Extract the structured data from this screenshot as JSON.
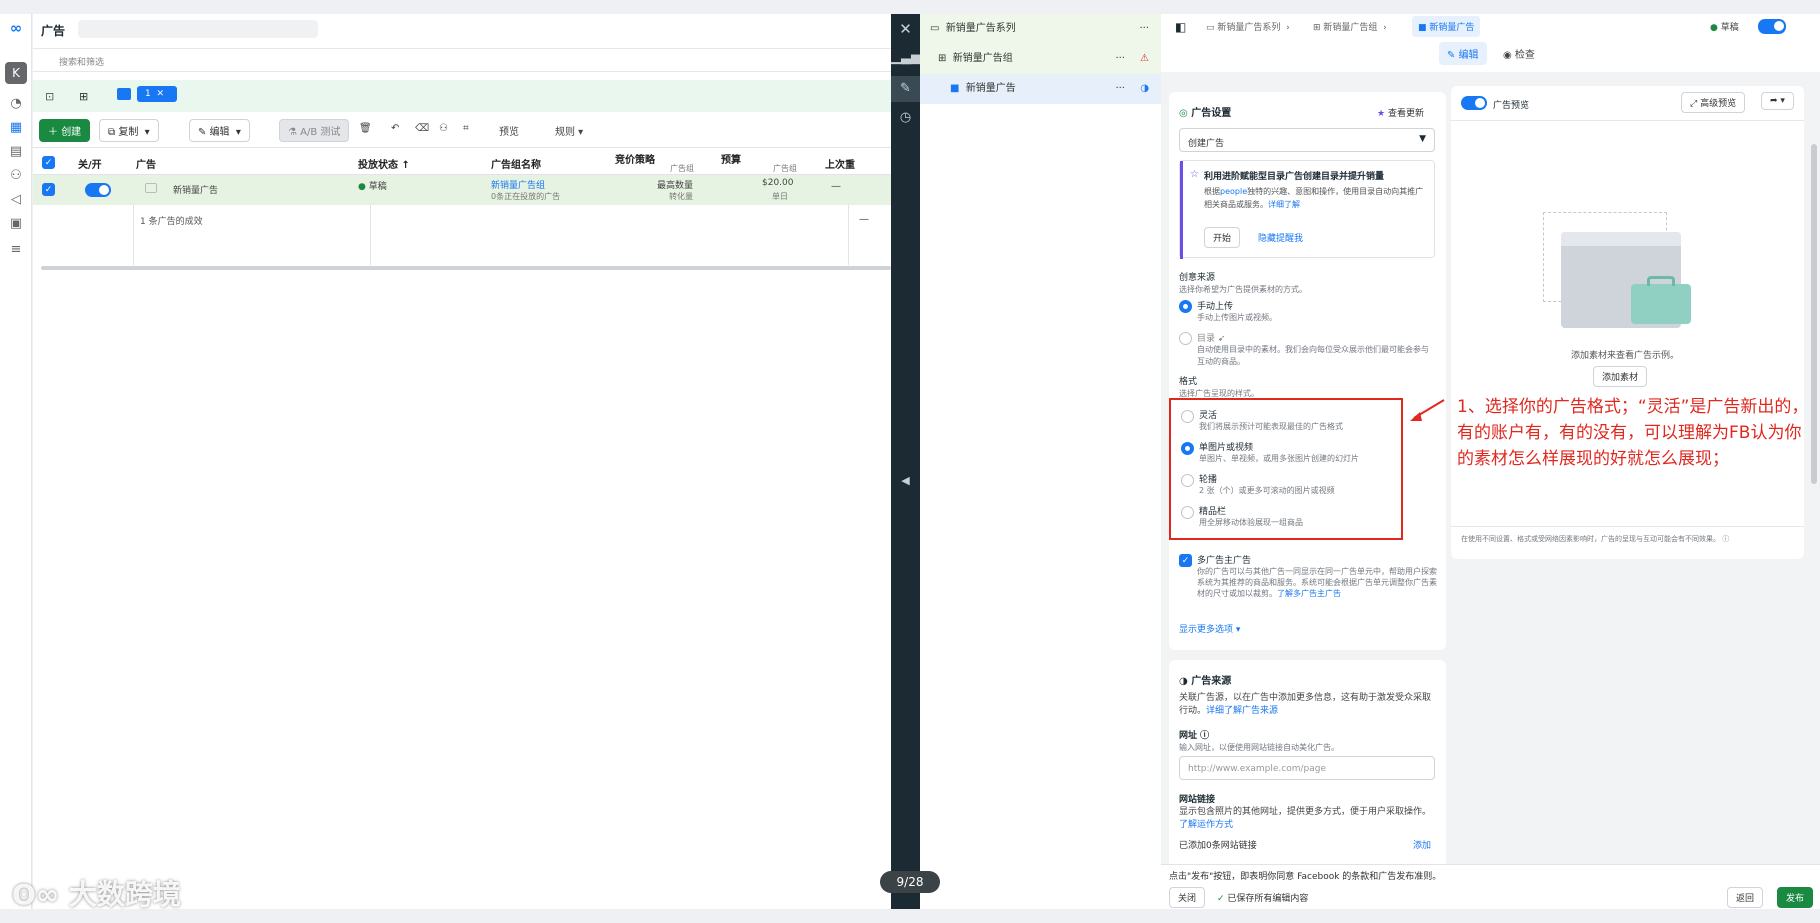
{
  "main": {
    "title": "广告",
    "search_placeholder": "搜索和筛选",
    "tab_count": "1",
    "toolbar": {
      "create": "创建",
      "copy": "复制",
      "edit": "编辑",
      "ab_test": "A/B 测试",
      "preview": "预览",
      "rules": "规则"
    },
    "columns": [
      "关/开",
      "广告",
      "投放状态 ↑",
      "广告组名称",
      "竞价策略",
      "预算",
      "上次重"
    ],
    "column_subs": {
      "bid": "广告组",
      "budget": "广告组"
    },
    "row": {
      "name": "新销量广告",
      "status": "草稿",
      "adset": "新销量广告组",
      "adset_sub": "0条正在投放的广告",
      "bid": "最高数量",
      "bid_sub": "转化量",
      "budget": "$20.00",
      "budget_sub": "单日",
      "dash": "—"
    },
    "result_row": "1 条广告的成效",
    "result_dash": "—"
  },
  "tree": {
    "campaign": "新销量广告系列",
    "adset": "新销量广告组",
    "ad": "新销量广告"
  },
  "editor": {
    "breadcrumb": [
      "新销量广告系列",
      "新销量广告组",
      "新销量广告"
    ],
    "status": "草稿",
    "tab_edit": "编辑",
    "tab_review": "检查",
    "ad_settings": {
      "title": "广告设置",
      "updates": "查看更新",
      "select": "创建广告",
      "promo_title": "利用进阶赋能型目录广告创建目录并提升销量",
      "promo_body_1": "根据",
      "promo_link_people": "people",
      "promo_body_2": "独特的兴趣、意图和操作，使用目录自动向其推广相关商品或服务。",
      "promo_link_more": "详细了解",
      "promo_start": "开始",
      "promo_hide": "隐藏提醒我",
      "creative_source": "创意来源",
      "creative_source_sub": "选择你希望为广告提供素材的方式。",
      "manual": "手动上传",
      "manual_sub": "手动上传图片或视频。",
      "catalog": "目录",
      "catalog_sub": "自动使用目录中的素材。我们会向每位受众展示他们最可能会参与互动的商品。",
      "format": "格式",
      "format_sub": "选择广告呈现的样式。",
      "formats": [
        {
          "name": "灵活",
          "sub": "我们将展示预计可能表现最佳的广告格式"
        },
        {
          "name": "单图片或视频",
          "sub": "单图片、单视频，或用多张图片创建的幻灯片"
        },
        {
          "name": "轮播",
          "sub": "2 张（个）或更多可滚动的图片或视频"
        },
        {
          "name": "精品栏",
          "sub": "用全屏移动体验展现一组商品"
        }
      ],
      "multi_ad": "多广告主广告",
      "multi_ad_sub": "你的广告可以与其他广告一同显示在同一广告单元中，帮助用户探索系统为其推荐的商品和服务。系统可能会根据广告单元调整你广告素材的尺寸或加以裁剪。",
      "multi_ad_link": "了解多广告主广告",
      "more_options": "显示更多选项 ▾"
    },
    "ad_source": {
      "title": "广告来源",
      "body": "关联广告源，以在广告中添加更多信息，这有助于激发受众采取行动。",
      "body_link": "详细了解广告来源",
      "url_label": "网址",
      "url_sub": "输入网址，以便使用网站链接自动美化广告。",
      "url_placeholder": "http://www.example.com/page",
      "sitelinks": "网站链接",
      "sitelinks_body": "显示包含照片的其他网址，提供更多方式，便于用户采取操作。",
      "sitelinks_link": "了解运作方式",
      "added": "已添加0条网站链接",
      "add": "添加"
    },
    "preview": {
      "label": "广告预览",
      "advanced": "高级预览",
      "add_media_text": "添加素材来查看广告示例。",
      "add_media": "添加素材",
      "footer": "在使用不同设置、格式或受网络因素影响时，广告的呈现与互动可能会有不同效果。"
    },
    "footer": {
      "terms": "点击\"发布\"按钮，即表明你同意 Facebook 的条款和广告发布准则。",
      "close": "关闭",
      "saved": "已保存所有编辑内容",
      "back": "返回",
      "publish": "发布"
    },
    "annotation": "1、选择你的广告格式；“灵活”是广告新出的，有的账户有，有的没有，可以理解为FB认为你的素材怎么样展现的好就怎么展现；"
  },
  "pager": "9/28",
  "watermark": "大数跨境",
  "avatar_letter": "K",
  "colors": {
    "accent": "#1877f2",
    "green": "#1a8a43",
    "annotation": "#e0281f",
    "dark": "#1c2b33"
  }
}
